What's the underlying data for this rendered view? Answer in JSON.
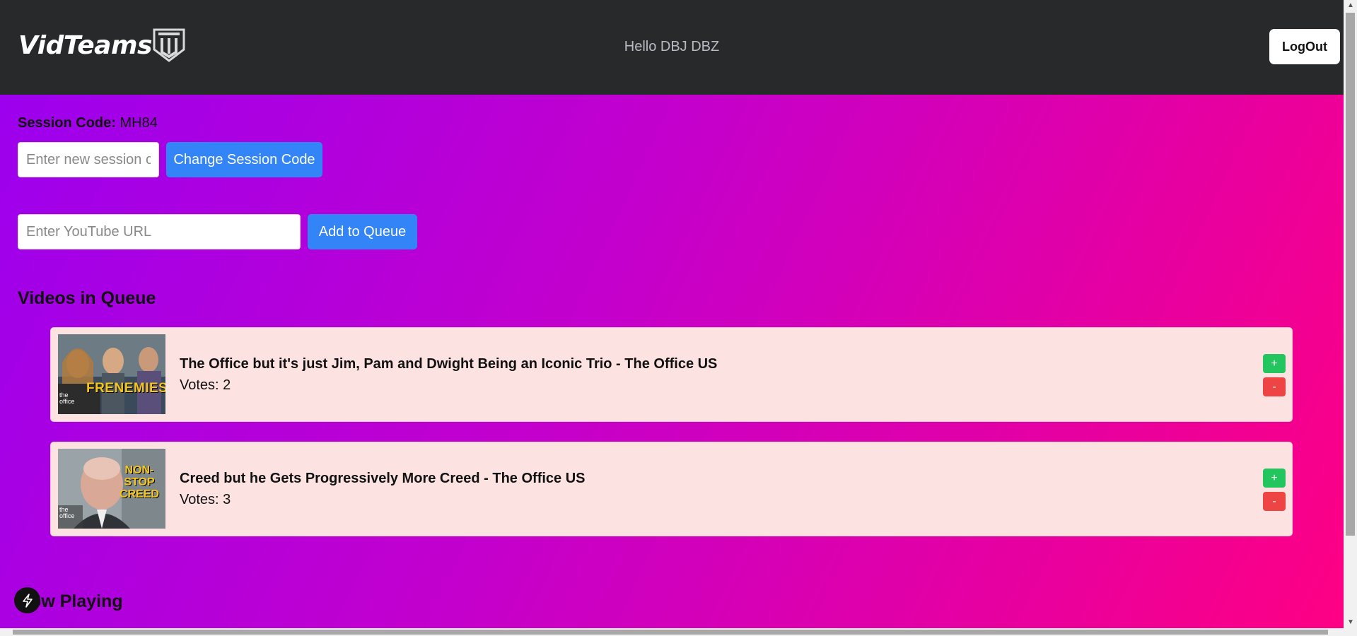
{
  "header": {
    "brand": "VidTeams",
    "logo_icon": "vt-shield-logo-icon",
    "greeting": "Hello DBJ DBZ",
    "logout_label": "LogOut"
  },
  "session": {
    "label": "Session Code:",
    "code": "MH84",
    "input_placeholder": "Enter new session code",
    "change_button": "Change Session Code"
  },
  "queue_form": {
    "url_placeholder": "Enter YouTube URL",
    "add_button": "Add to Queue"
  },
  "queue": {
    "title": "Videos in Queue",
    "items": [
      {
        "title": "The Office but it's just Jim, Pam and Dwight Being an Iconic Trio - The Office US",
        "votes": "Votes: 2",
        "thumb_text": "FRENEMIES.",
        "thumb_brand": "the office",
        "plus_label": "+",
        "minus_label": "-"
      },
      {
        "title": "Creed but he Gets Progressively More Creed - The Office US",
        "votes": "Votes: 3",
        "thumb_text": "NON-STOP CREED",
        "thumb_brand": "the office",
        "plus_label": "+",
        "minus_label": "-"
      }
    ]
  },
  "now_playing": {
    "title": "Now Playing"
  },
  "colors": {
    "header_bg": "#28292b",
    "accent_blue": "#3384f7",
    "upvote_green": "#22c55e",
    "downvote_red": "#ef4444",
    "card_bg": "#fde2e2"
  }
}
